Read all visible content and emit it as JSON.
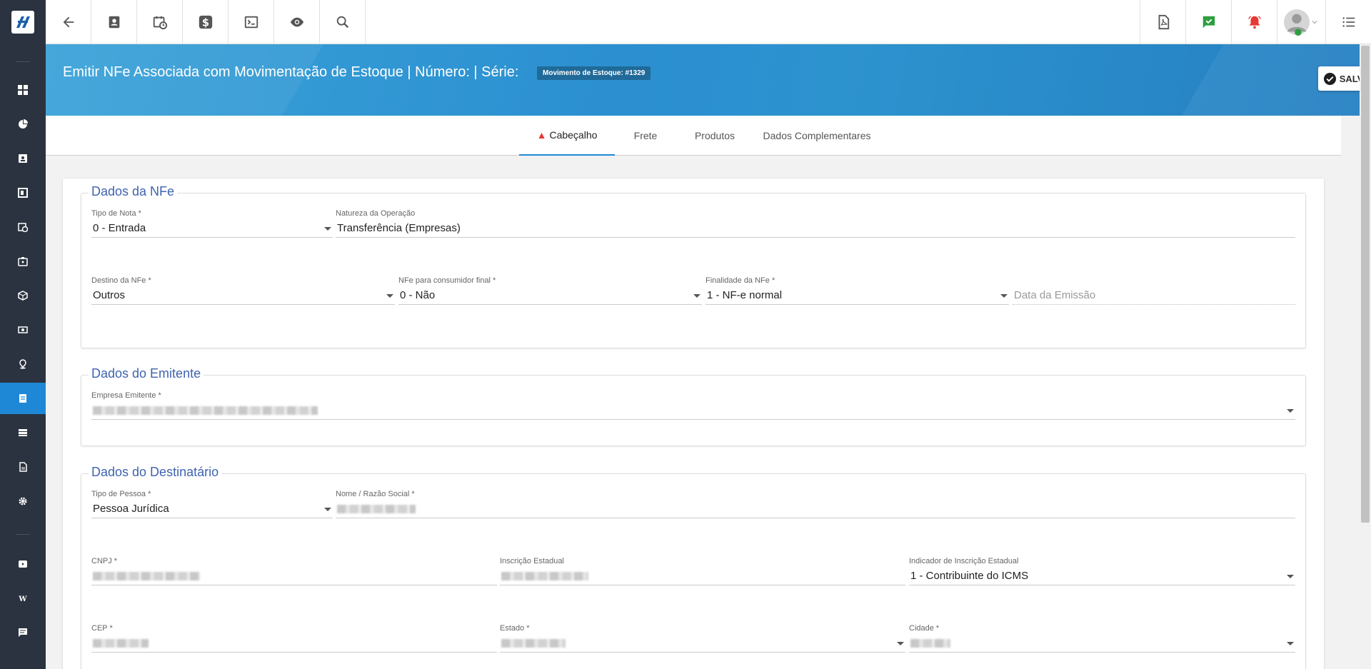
{
  "header": {
    "title": "Emitir NFe Associada com Movimentação de Estoque | Número: | Série:",
    "badge": "Movimento de Estoque: #1329",
    "save_label": "SALVAR"
  },
  "toolbar": {
    "buttons": [
      "back-icon",
      "contact-icon",
      "schedule-icon",
      "dollar-icon",
      "terminal-icon",
      "eye-icon",
      "search-icon"
    ],
    "right_buttons": [
      "pdf-icon",
      "chat-check-icon",
      "bell-icon",
      "avatar",
      "menu-list-icon"
    ]
  },
  "sidebar": {
    "items": [
      "dashboard-icon",
      "chart-pie-icon",
      "contact-card-icon",
      "board-icon",
      "calendar-clock-icon",
      "badge-icon",
      "box-icon",
      "money-icon",
      "location-icon",
      "document-icon",
      "list-icon",
      "file-icon",
      "gear-icon",
      "video-icon",
      "wiki-icon",
      "chat-icon"
    ],
    "active_index": 9
  },
  "tabs": [
    {
      "label": "Cabeçalho",
      "active": true,
      "warning": true
    },
    {
      "label": "Frete",
      "active": false
    },
    {
      "label": "Produtos",
      "active": false
    },
    {
      "label": "Dados Complementares",
      "active": false
    }
  ],
  "nfe": {
    "title": "Dados da NFe",
    "tipo_nota": {
      "label": "Tipo de Nota *",
      "value": "0 - Entrada"
    },
    "natureza": {
      "label": "Natureza da Operação",
      "value": "Transferência (Empresas)"
    },
    "destino": {
      "label": "Destino da NFe *",
      "value": "Outros"
    },
    "consumidor": {
      "label": "NFe para consumidor final *",
      "value": "0 - Não"
    },
    "finalidade": {
      "label": "Finalidade da NFe *",
      "value": "1 - NF-e normal"
    },
    "data_emissao": {
      "placeholder": "Data da Emissão"
    }
  },
  "emitente": {
    "title": "Dados do Emitente",
    "empresa": {
      "label": "Empresa Emitente *"
    }
  },
  "destinatario": {
    "title": "Dados do Destinatário",
    "tipo_pessoa": {
      "label": "Tipo de Pessoa *",
      "value": "Pessoa Jurídica"
    },
    "nome": {
      "label": "Nome / Razão Social *"
    },
    "cnpj": {
      "label": "CNPJ *"
    },
    "ie": {
      "label": "Inscrição Estadual"
    },
    "indicador_ie": {
      "label": "Indicador de Inscrição Estadual",
      "value": "1 - Contribuinte do ICMS"
    },
    "cep": {
      "label": "CEP *"
    },
    "estado": {
      "label": "Estado *"
    },
    "cidade": {
      "label": "Cidade *"
    }
  },
  "colors": {
    "accent": "#1e88d6",
    "sidebar": "#2b3340",
    "section_title": "#3f63b0"
  }
}
